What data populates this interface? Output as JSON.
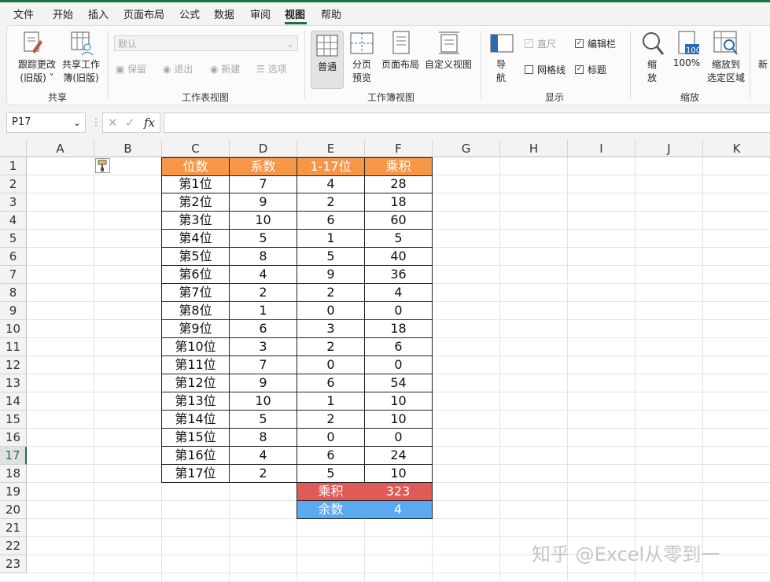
{
  "menu": {
    "items": [
      "文件",
      "开始",
      "插入",
      "页面布局",
      "公式",
      "数据",
      "审阅",
      "视图",
      "帮助"
    ],
    "active": "视图"
  },
  "ribbon": {
    "share_group": {
      "label": "共享",
      "track_changes": [
        "跟踪更改",
        "(旧版) ˅"
      ],
      "share_workbook": [
        "共享工作",
        "簿(旧版)"
      ]
    },
    "sheet_view_group": {
      "label": "工作表视图",
      "default_value": "默认",
      "keep": "保留",
      "exit": "退出",
      "new": "新建",
      "options": "选项"
    },
    "workbook_view_group": {
      "label": "工作簿视图",
      "normal": "普通",
      "page_break": [
        "分页",
        "预览"
      ],
      "page_layout": "页面布局",
      "custom_view": "自定义视图"
    },
    "show_group": {
      "label": "显示",
      "navigation": [
        "导",
        "航"
      ],
      "ruler": "直尺",
      "formula_bar": "编辑栏",
      "gridlines": "网格线",
      "headings": "标题"
    },
    "zoom_group": {
      "label": "缩放",
      "zoom": [
        "缩",
        "放"
      ],
      "zoom_100": "100%",
      "zoom_100_icon_text": "100",
      "zoom_to_selection": [
        "缩放到",
        "选定区域"
      ],
      "new_window_partial": "新"
    }
  },
  "formula_bar": {
    "name_box": "P17",
    "fx": "fx",
    "content": ""
  },
  "sheet": {
    "columns": [
      "A",
      "B",
      "C",
      "D",
      "E",
      "F",
      "G",
      "H",
      "I",
      "J",
      "K"
    ],
    "rows": [
      "1",
      "2",
      "3",
      "4",
      "5",
      "6",
      "7",
      "8",
      "9",
      "10",
      "11",
      "12",
      "13",
      "14",
      "15",
      "16",
      "17",
      "18",
      "19",
      "20",
      "21",
      "22",
      "23"
    ],
    "selected_row": "17",
    "header": [
      "位数",
      "系数",
      "1-17位",
      "乘积"
    ],
    "data": [
      [
        "第1位",
        "7",
        "4",
        "28"
      ],
      [
        "第2位",
        "9",
        "2",
        "18"
      ],
      [
        "第3位",
        "10",
        "6",
        "60"
      ],
      [
        "第4位",
        "5",
        "1",
        "5"
      ],
      [
        "第5位",
        "8",
        "5",
        "40"
      ],
      [
        "第6位",
        "4",
        "9",
        "36"
      ],
      [
        "第7位",
        "2",
        "2",
        "4"
      ],
      [
        "第8位",
        "1",
        "0",
        "0"
      ],
      [
        "第9位",
        "6",
        "3",
        "18"
      ],
      [
        "第10位",
        "3",
        "2",
        "6"
      ],
      [
        "第11位",
        "7",
        "0",
        "0"
      ],
      [
        "第12位",
        "9",
        "6",
        "54"
      ],
      [
        "第13位",
        "10",
        "1",
        "10"
      ],
      [
        "第14位",
        "5",
        "2",
        "10"
      ],
      [
        "第15位",
        "8",
        "0",
        "0"
      ],
      [
        "第16位",
        "4",
        "6",
        "24"
      ],
      [
        "第17位",
        "2",
        "5",
        "10"
      ]
    ],
    "summary": [
      {
        "label": "乘积",
        "value": "323",
        "color": "#e05a57"
      },
      {
        "label": "余数",
        "value": "4",
        "color": "#5aa9f2"
      }
    ],
    "header_color": "#f79646"
  },
  "watermark": "知乎 @Excel从零到一"
}
